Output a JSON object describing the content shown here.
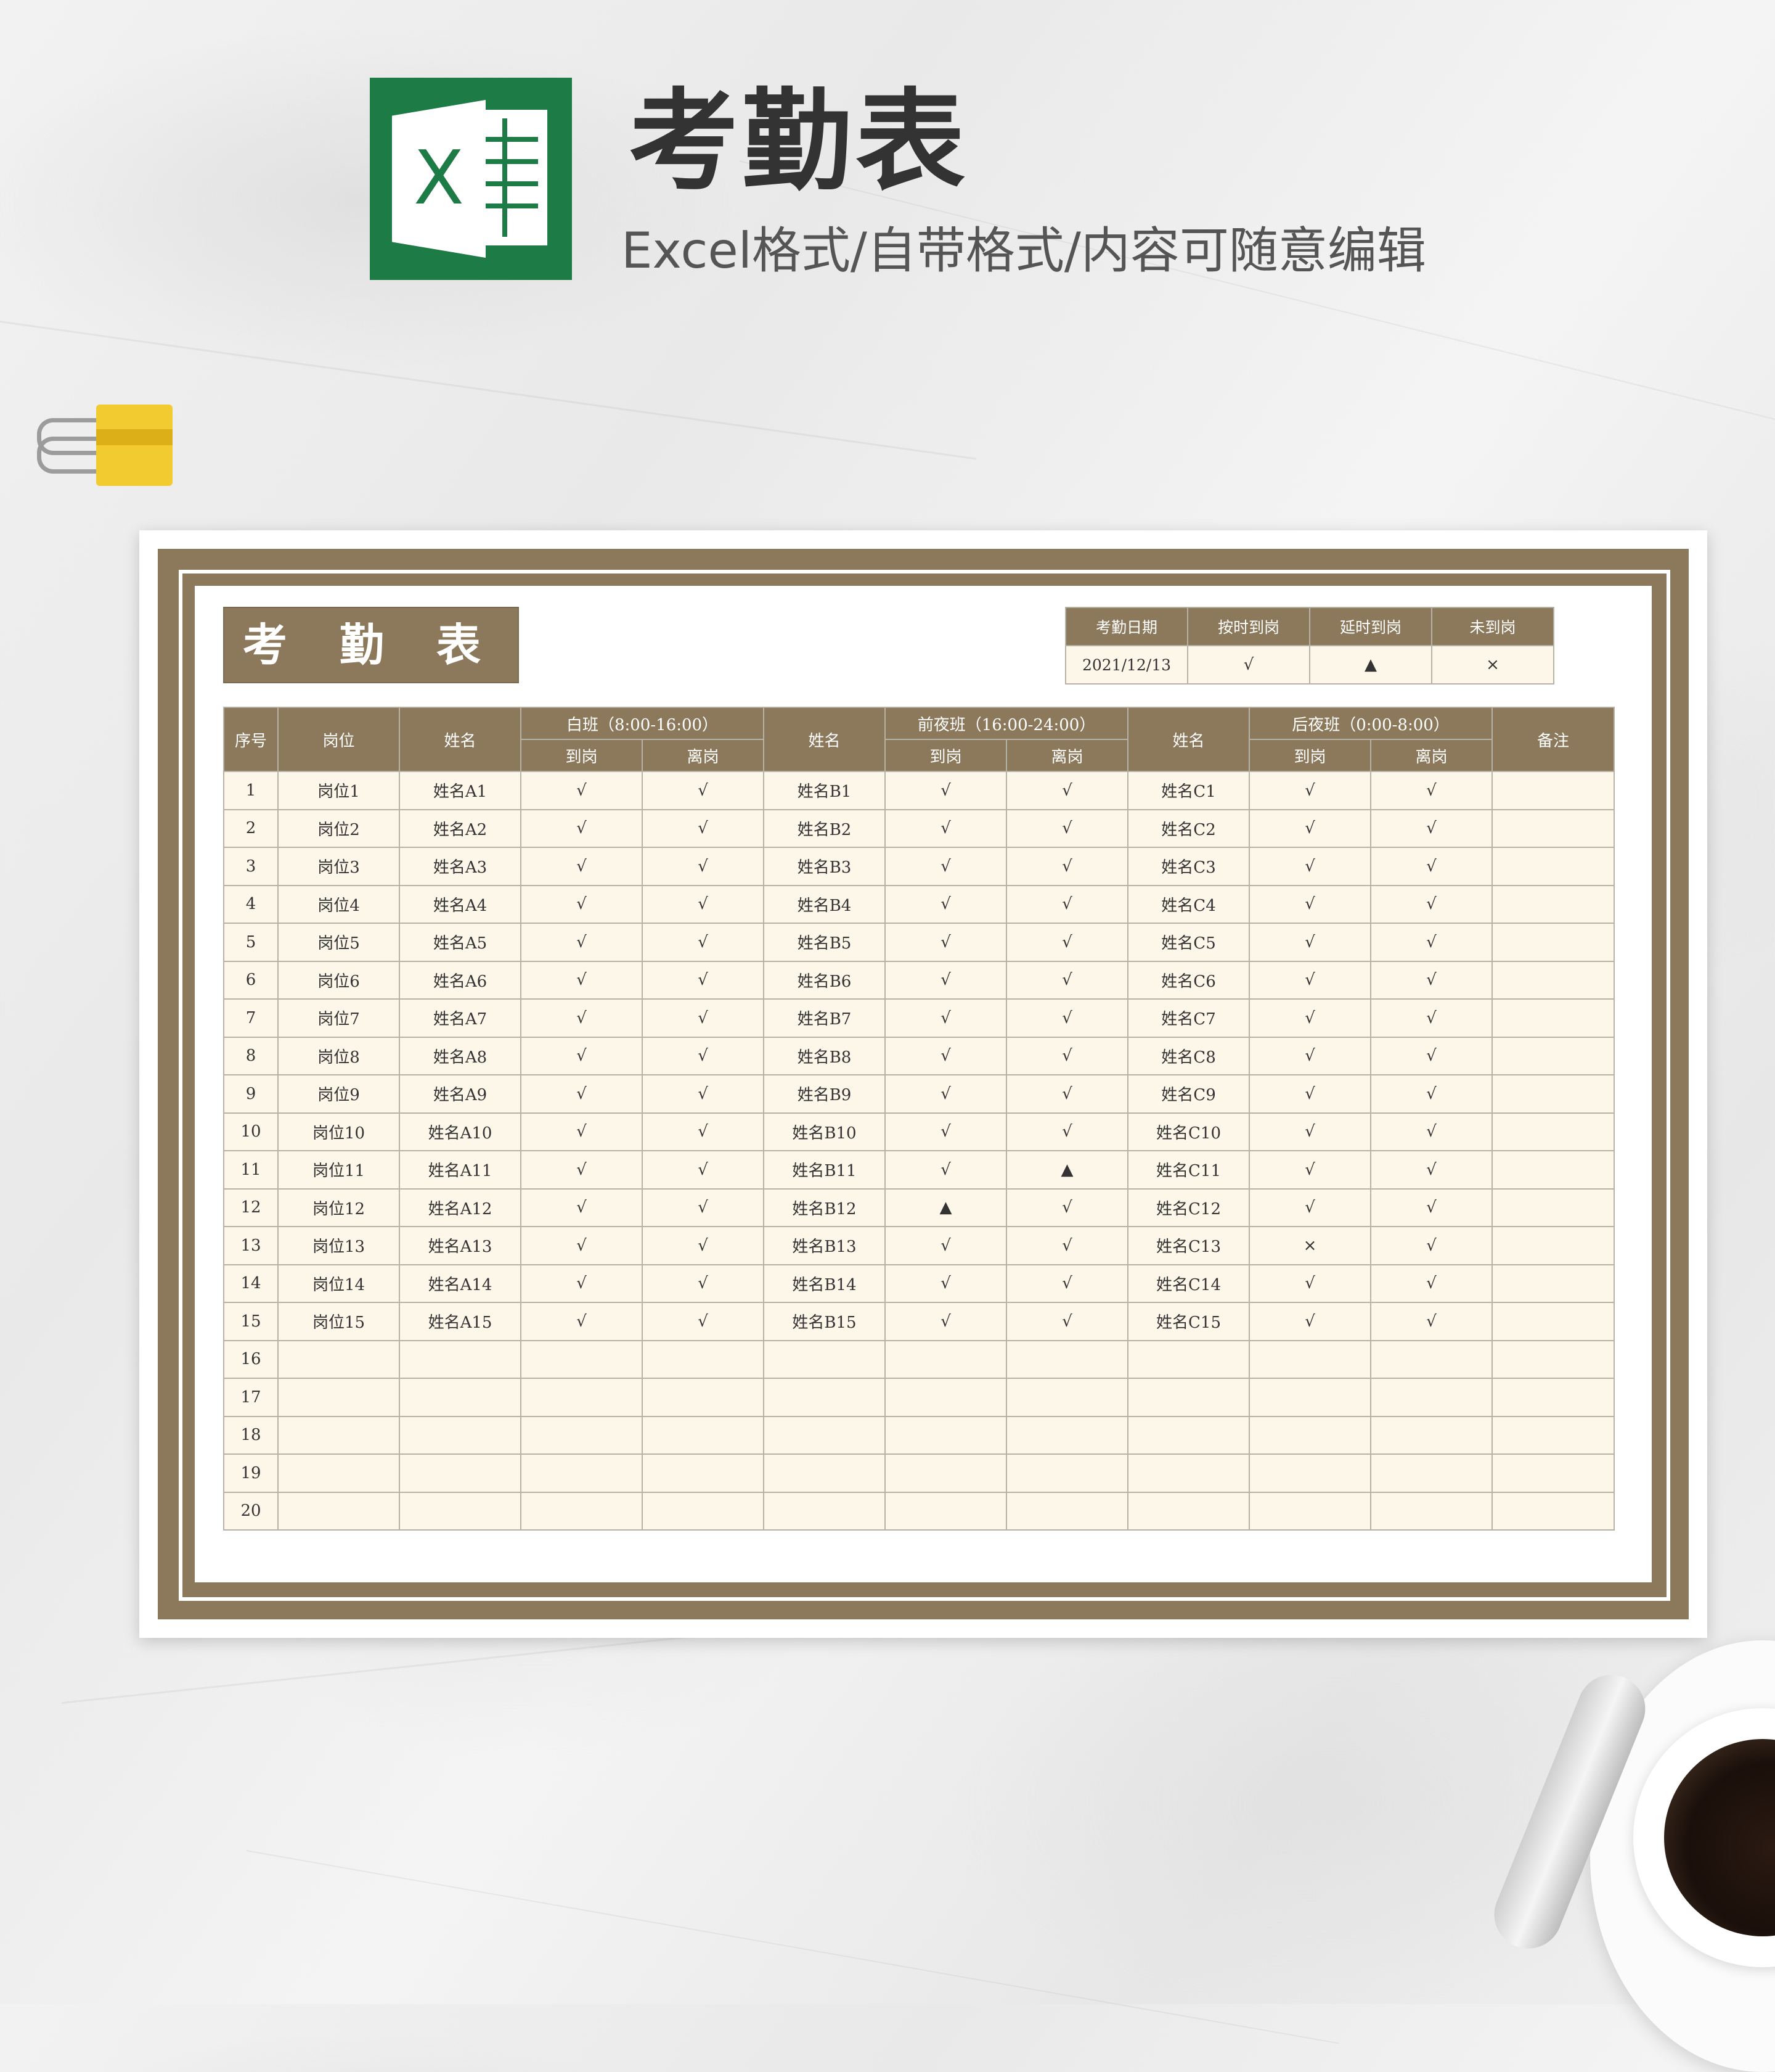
{
  "hero": {
    "title": "考勤表",
    "subtitle": "Excel格式/自带格式/内容可随意编辑",
    "logo_letter": "X"
  },
  "sheet": {
    "title": "考 勤 表",
    "legend": {
      "headers": [
        "考勤日期",
        "按时到岗",
        "延时到岗",
        "未到岗"
      ],
      "values": [
        "2021/12/13",
        "√",
        "▲",
        "×"
      ]
    },
    "headers": {
      "index": "序号",
      "post": "岗位",
      "name": "姓名",
      "shift_day": "白班（8:00-16:00）",
      "shift_evening": "前夜班（16:00-24:00）",
      "shift_night": "后夜班（0:00-8:00）",
      "arrive": "到岗",
      "leave": "离岗",
      "note": "备注"
    },
    "rows": [
      [
        "1",
        "岗位1",
        "姓名A1",
        "√",
        "√",
        "姓名B1",
        "√",
        "√",
        "姓名C1",
        "√",
        "√",
        ""
      ],
      [
        "2",
        "岗位2",
        "姓名A2",
        "√",
        "√",
        "姓名B2",
        "√",
        "√",
        "姓名C2",
        "√",
        "√",
        ""
      ],
      [
        "3",
        "岗位3",
        "姓名A3",
        "√",
        "√",
        "姓名B3",
        "√",
        "√",
        "姓名C3",
        "√",
        "√",
        ""
      ],
      [
        "4",
        "岗位4",
        "姓名A4",
        "√",
        "√",
        "姓名B4",
        "√",
        "√",
        "姓名C4",
        "√",
        "√",
        ""
      ],
      [
        "5",
        "岗位5",
        "姓名A5",
        "√",
        "√",
        "姓名B5",
        "√",
        "√",
        "姓名C5",
        "√",
        "√",
        ""
      ],
      [
        "6",
        "岗位6",
        "姓名A6",
        "√",
        "√",
        "姓名B6",
        "√",
        "√",
        "姓名C6",
        "√",
        "√",
        ""
      ],
      [
        "7",
        "岗位7",
        "姓名A7",
        "√",
        "√",
        "姓名B7",
        "√",
        "√",
        "姓名C7",
        "√",
        "√",
        ""
      ],
      [
        "8",
        "岗位8",
        "姓名A8",
        "√",
        "√",
        "姓名B8",
        "√",
        "√",
        "姓名C8",
        "√",
        "√",
        ""
      ],
      [
        "9",
        "岗位9",
        "姓名A9",
        "√",
        "√",
        "姓名B9",
        "√",
        "√",
        "姓名C9",
        "√",
        "√",
        ""
      ],
      [
        "10",
        "岗位10",
        "姓名A10",
        "√",
        "√",
        "姓名B10",
        "√",
        "√",
        "姓名C10",
        "√",
        "√",
        ""
      ],
      [
        "11",
        "岗位11",
        "姓名A11",
        "√",
        "√",
        "姓名B11",
        "√",
        "▲",
        "姓名C11",
        "√",
        "√",
        ""
      ],
      [
        "12",
        "岗位12",
        "姓名A12",
        "√",
        "√",
        "姓名B12",
        "▲",
        "√",
        "姓名C12",
        "√",
        "√",
        ""
      ],
      [
        "13",
        "岗位13",
        "姓名A13",
        "√",
        "√",
        "姓名B13",
        "√",
        "√",
        "姓名C13",
        "×",
        "√",
        ""
      ],
      [
        "14",
        "岗位14",
        "姓名A14",
        "√",
        "√",
        "姓名B14",
        "√",
        "√",
        "姓名C14",
        "√",
        "√",
        ""
      ],
      [
        "15",
        "岗位15",
        "姓名A15",
        "√",
        "√",
        "姓名B15",
        "√",
        "√",
        "姓名C15",
        "√",
        "√",
        ""
      ],
      [
        "16",
        "",
        "",
        "",
        "",
        "",
        "",
        "",
        "",
        "",
        "",
        ""
      ],
      [
        "17",
        "",
        "",
        "",
        "",
        "",
        "",
        "",
        "",
        "",
        "",
        ""
      ],
      [
        "18",
        "",
        "",
        "",
        "",
        "",
        "",
        "",
        "",
        "",
        "",
        ""
      ],
      [
        "19",
        "",
        "",
        "",
        "",
        "",
        "",
        "",
        "",
        "",
        "",
        ""
      ],
      [
        "20",
        "",
        "",
        "",
        "",
        "",
        "",
        "",
        "",
        "",
        "",
        ""
      ]
    ]
  },
  "colors": {
    "header_bg": "#8c795b",
    "cell_bg": "#fdf7ea",
    "excel_green": "#1d7b45"
  }
}
